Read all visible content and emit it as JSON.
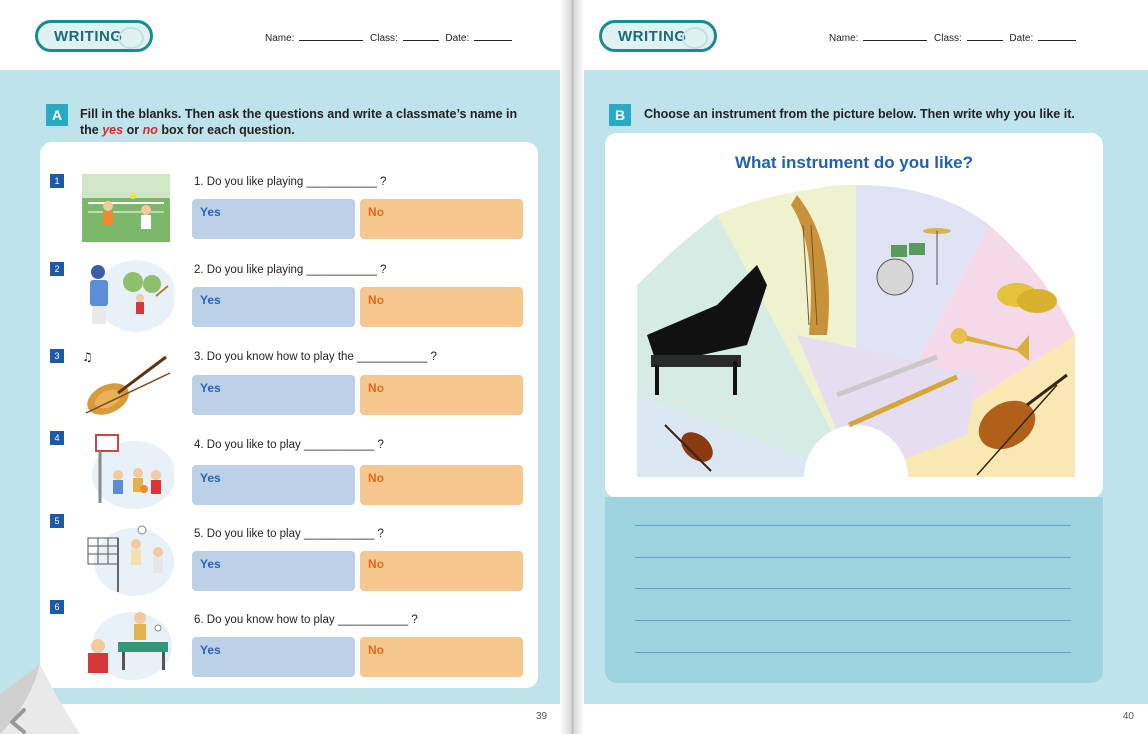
{
  "left_page": {
    "badge": "WRITING",
    "name_label": "Name:",
    "class_label": "Class:",
    "date_label": "Date:",
    "section_letter": "A",
    "instruction_line1": "Fill in the blanks. Then ask the questions and write a classmate’s name in",
    "instruction_the": "the",
    "instruction_yes": "yes",
    "instruction_or": "or",
    "instruction_no": "no",
    "instruction_rest": "box for each question.",
    "yes_label": "Yes",
    "no_label": "No",
    "questions": [
      {
        "num": "1",
        "text": "1. Do you like playing ___________ ?"
      },
      {
        "num": "2",
        "text": "2. Do you like playing ___________ ?"
      },
      {
        "num": "3",
        "text": "3. Do you know how to play the ___________ ?"
      },
      {
        "num": "4",
        "text": "4. Do you like to play ___________ ?"
      },
      {
        "num": "5",
        "text": "5. Do you like to play ___________ ?"
      },
      {
        "num": "6",
        "text": "6. Do you know how to play ___________ ?"
      }
    ],
    "page_number": "39"
  },
  "right_page": {
    "badge": "WRITING",
    "name_label": "Name:",
    "class_label": "Class:",
    "date_label": "Date:",
    "section_letter": "B",
    "instruction": "Choose an instrument from the picture below. Then write why you like it.",
    "chart_title": "What instrument do you like?",
    "page_number": "40"
  },
  "colors": {
    "band": "#bfe3ea",
    "section_label": "#29a9c4",
    "yes_box": "#bcd1e8",
    "no_box": "#f6c890",
    "title_blue": "#1f62b3",
    "badge_border": "#1b8c8c"
  }
}
